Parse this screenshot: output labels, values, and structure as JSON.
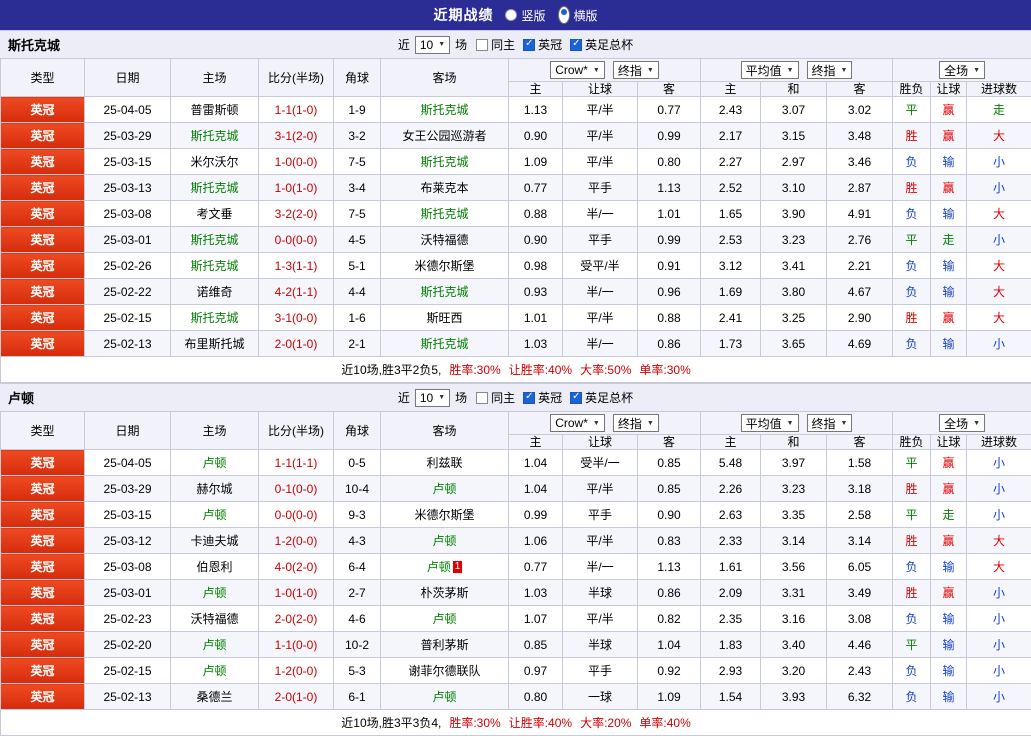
{
  "palette": {
    "topbar_bg": "#2c2c95",
    "league_badge_bg": "#e23b17",
    "team_green": "#008000",
    "score_red": "#cc0000",
    "win_red": "#e00000",
    "draw_green": "#008000",
    "lose_blue": "#1440cc",
    "checkbox_blue": "#1a62d6"
  },
  "topbar": {
    "title": "近期战绩",
    "options": [
      {
        "label": "竖版",
        "selected": false
      },
      {
        "label": "横版",
        "selected": true
      }
    ]
  },
  "filter": {
    "prefix": "近",
    "count": "10",
    "suffix": "场",
    "checkboxes": [
      {
        "label": "同主",
        "checked": false
      },
      {
        "label": "英冠",
        "checked": true
      },
      {
        "label": "英足总杯",
        "checked": true
      }
    ]
  },
  "selects": {
    "asia_source": "Crow*",
    "asia_type": "终指",
    "euro_source": "平均值",
    "euro_type": "终指",
    "full": "全场"
  },
  "table_headers": {
    "cols": [
      "类型",
      "日期",
      "主场",
      "比分(半场)",
      "角球",
      "客场"
    ],
    "asia_sub": [
      "主",
      "让球",
      "客"
    ],
    "euro_sub": [
      "主",
      "和",
      "客"
    ],
    "full_sub": [
      "胜负",
      "让球",
      "进球数"
    ]
  },
  "sections": [
    {
      "team": "斯托克城",
      "rows": [
        {
          "league": "英冠",
          "date": "25-04-05",
          "home": "普雷斯顿",
          "home_team": false,
          "score": "1-1(1-0)",
          "corner": "1-9",
          "away": "斯托克城",
          "away_team": true,
          "away_card": "",
          "ah": [
            "1.13",
            "平/半",
            "0.77"
          ],
          "eu": [
            "2.43",
            "3.07",
            "3.02"
          ],
          "res": [
            [
              "平",
              "d"
            ],
            [
              "赢",
              "w"
            ],
            [
              "走",
              "d"
            ]
          ]
        },
        {
          "league": "英冠",
          "date": "25-03-29",
          "home": "斯托克城",
          "home_team": true,
          "score": "3-1(2-0)",
          "corner": "3-2",
          "away": "女王公园巡游者",
          "away_team": false,
          "away_card": "",
          "ah": [
            "0.90",
            "平/半",
            "0.99"
          ],
          "eu": [
            "2.17",
            "3.15",
            "3.48"
          ],
          "res": [
            [
              "胜",
              "w"
            ],
            [
              "赢",
              "w"
            ],
            [
              "大",
              "w"
            ]
          ]
        },
        {
          "league": "英冠",
          "date": "25-03-15",
          "home": "米尔沃尔",
          "home_team": false,
          "score": "1-0(0-0)",
          "corner": "7-5",
          "away": "斯托克城",
          "away_team": true,
          "away_card": "",
          "ah": [
            "1.09",
            "平/半",
            "0.80"
          ],
          "eu": [
            "2.27",
            "2.97",
            "3.46"
          ],
          "res": [
            [
              "负",
              "l"
            ],
            [
              "输",
              "l"
            ],
            [
              "小",
              "l"
            ]
          ]
        },
        {
          "league": "英冠",
          "date": "25-03-13",
          "home": "斯托克城",
          "home_team": true,
          "score": "1-0(1-0)",
          "corner": "3-4",
          "away": "布莱克本",
          "away_team": false,
          "away_card": "",
          "ah": [
            "0.77",
            "平手",
            "1.13"
          ],
          "eu": [
            "2.52",
            "3.10",
            "2.87"
          ],
          "res": [
            [
              "胜",
              "w"
            ],
            [
              "赢",
              "w"
            ],
            [
              "小",
              "l"
            ]
          ]
        },
        {
          "league": "英冠",
          "date": "25-03-08",
          "home": "考文垂",
          "home_team": false,
          "score": "3-2(2-0)",
          "corner": "7-5",
          "away": "斯托克城",
          "away_team": true,
          "away_card": "",
          "ah": [
            "0.88",
            "半/一",
            "1.01"
          ],
          "eu": [
            "1.65",
            "3.90",
            "4.91"
          ],
          "res": [
            [
              "负",
              "l"
            ],
            [
              "输",
              "l"
            ],
            [
              "大",
              "w"
            ]
          ]
        },
        {
          "league": "英冠",
          "date": "25-03-01",
          "home": "斯托克城",
          "home_team": true,
          "score": "0-0(0-0)",
          "corner": "4-5",
          "away": "沃特福德",
          "away_team": false,
          "away_card": "",
          "ah": [
            "0.90",
            "平手",
            "0.99"
          ],
          "eu": [
            "2.53",
            "3.23",
            "2.76"
          ],
          "res": [
            [
              "平",
              "d"
            ],
            [
              "走",
              "d"
            ],
            [
              "小",
              "l"
            ]
          ]
        },
        {
          "league": "英冠",
          "date": "25-02-26",
          "home": "斯托克城",
          "home_team": true,
          "score": "1-3(1-1)",
          "corner": "5-1",
          "away": "米德尔斯堡",
          "away_team": false,
          "away_card": "",
          "ah": [
            "0.98",
            "受平/半",
            "0.91"
          ],
          "eu": [
            "3.12",
            "3.41",
            "2.21"
          ],
          "res": [
            [
              "负",
              "l"
            ],
            [
              "输",
              "l"
            ],
            [
              "大",
              "w"
            ]
          ]
        },
        {
          "league": "英冠",
          "date": "25-02-22",
          "home": "诺维奇",
          "home_team": false,
          "score": "4-2(1-1)",
          "corner": "4-4",
          "away": "斯托克城",
          "away_team": true,
          "away_card": "",
          "ah": [
            "0.93",
            "半/一",
            "0.96"
          ],
          "eu": [
            "1.69",
            "3.80",
            "4.67"
          ],
          "res": [
            [
              "负",
              "l"
            ],
            [
              "输",
              "l"
            ],
            [
              "大",
              "w"
            ]
          ]
        },
        {
          "league": "英冠",
          "date": "25-02-15",
          "home": "斯托克城",
          "home_team": true,
          "score": "3-1(0-0)",
          "corner": "1-6",
          "away": "斯旺西",
          "away_team": false,
          "away_card": "",
          "ah": [
            "1.01",
            "平/半",
            "0.88"
          ],
          "eu": [
            "2.41",
            "3.25",
            "2.90"
          ],
          "res": [
            [
              "胜",
              "w"
            ],
            [
              "赢",
              "w"
            ],
            [
              "大",
              "w"
            ]
          ]
        },
        {
          "league": "英冠",
          "date": "25-02-13",
          "home": "布里斯托城",
          "home_team": false,
          "score": "2-0(1-0)",
          "corner": "2-1",
          "away": "斯托克城",
          "away_team": true,
          "away_card": "",
          "ah": [
            "1.03",
            "半/一",
            "0.86"
          ],
          "eu": [
            "1.73",
            "3.65",
            "4.69"
          ],
          "res": [
            [
              "负",
              "l"
            ],
            [
              "输",
              "l"
            ],
            [
              "小",
              "l"
            ]
          ]
        }
      ],
      "summary": {
        "lead": "近10场,胜3平2负5,",
        "stats": [
          "胜率:30%",
          "让胜率:40%",
          "大率:50%",
          "单率:30%"
        ]
      }
    },
    {
      "team": "卢顿",
      "rows": [
        {
          "league": "英冠",
          "date": "25-04-05",
          "home": "卢顿",
          "home_team": true,
          "score": "1-1(1-1)",
          "corner": "0-5",
          "away": "利兹联",
          "away_team": false,
          "away_card": "",
          "ah": [
            "1.04",
            "受半/一",
            "0.85"
          ],
          "eu": [
            "5.48",
            "3.97",
            "1.58"
          ],
          "res": [
            [
              "平",
              "d"
            ],
            [
              "赢",
              "w"
            ],
            [
              "小",
              "l"
            ]
          ]
        },
        {
          "league": "英冠",
          "date": "25-03-29",
          "home": "赫尔城",
          "home_team": false,
          "score": "0-1(0-0)",
          "corner": "10-4",
          "away": "卢顿",
          "away_team": true,
          "away_card": "",
          "ah": [
            "1.04",
            "平/半",
            "0.85"
          ],
          "eu": [
            "2.26",
            "3.23",
            "3.18"
          ],
          "res": [
            [
              "胜",
              "w"
            ],
            [
              "赢",
              "w"
            ],
            [
              "小",
              "l"
            ]
          ]
        },
        {
          "league": "英冠",
          "date": "25-03-15",
          "home": "卢顿",
          "home_team": true,
          "score": "0-0(0-0)",
          "corner": "9-3",
          "away": "米德尔斯堡",
          "away_team": false,
          "away_card": "",
          "ah": [
            "0.99",
            "平手",
            "0.90"
          ],
          "eu": [
            "2.63",
            "3.35",
            "2.58"
          ],
          "res": [
            [
              "平",
              "d"
            ],
            [
              "走",
              "d"
            ],
            [
              "小",
              "l"
            ]
          ]
        },
        {
          "league": "英冠",
          "date": "25-03-12",
          "home": "卡迪夫城",
          "home_team": false,
          "score": "1-2(0-0)",
          "corner": "4-3",
          "away": "卢顿",
          "away_team": true,
          "away_card": "",
          "ah": [
            "1.06",
            "平/半",
            "0.83"
          ],
          "eu": [
            "2.33",
            "3.14",
            "3.14"
          ],
          "res": [
            [
              "胜",
              "w"
            ],
            [
              "赢",
              "w"
            ],
            [
              "大",
              "w"
            ]
          ]
        },
        {
          "league": "英冠",
          "date": "25-03-08",
          "home": "伯恩利",
          "home_team": false,
          "score": "4-0(2-0)",
          "corner": "6-4",
          "away": "卢顿",
          "away_team": true,
          "away_card": "1",
          "ah": [
            "0.77",
            "半/一",
            "1.13"
          ],
          "eu": [
            "1.61",
            "3.56",
            "6.05"
          ],
          "res": [
            [
              "负",
              "l"
            ],
            [
              "输",
              "l"
            ],
            [
              "大",
              "w"
            ]
          ]
        },
        {
          "league": "英冠",
          "date": "25-03-01",
          "home": "卢顿",
          "home_team": true,
          "score": "1-0(1-0)",
          "corner": "2-7",
          "away": "朴茨茅斯",
          "away_team": false,
          "away_card": "",
          "ah": [
            "1.03",
            "半球",
            "0.86"
          ],
          "eu": [
            "2.09",
            "3.31",
            "3.49"
          ],
          "res": [
            [
              "胜",
              "w"
            ],
            [
              "赢",
              "w"
            ],
            [
              "小",
              "l"
            ]
          ]
        },
        {
          "league": "英冠",
          "date": "25-02-23",
          "home": "沃特福德",
          "home_team": false,
          "score": "2-0(2-0)",
          "corner": "4-6",
          "away": "卢顿",
          "away_team": true,
          "away_card": "",
          "ah": [
            "1.07",
            "平/半",
            "0.82"
          ],
          "eu": [
            "2.35",
            "3.16",
            "3.08"
          ],
          "res": [
            [
              "负",
              "l"
            ],
            [
              "输",
              "l"
            ],
            [
              "小",
              "l"
            ]
          ]
        },
        {
          "league": "英冠",
          "date": "25-02-20",
          "home": "卢顿",
          "home_team": true,
          "score": "1-1(0-0)",
          "corner": "10-2",
          "away": "普利茅斯",
          "away_team": false,
          "away_card": "",
          "ah": [
            "0.85",
            "半球",
            "1.04"
          ],
          "eu": [
            "1.83",
            "3.40",
            "4.46"
          ],
          "res": [
            [
              "平",
              "d"
            ],
            [
              "输",
              "l"
            ],
            [
              "小",
              "l"
            ]
          ]
        },
        {
          "league": "英冠",
          "date": "25-02-15",
          "home": "卢顿",
          "home_team": true,
          "score": "1-2(0-0)",
          "corner": "5-3",
          "away": "谢菲尔德联队",
          "away_team": false,
          "away_card": "",
          "ah": [
            "0.97",
            "平手",
            "0.92"
          ],
          "eu": [
            "2.93",
            "3.20",
            "2.43"
          ],
          "res": [
            [
              "负",
              "l"
            ],
            [
              "输",
              "l"
            ],
            [
              "小",
              "l"
            ]
          ]
        },
        {
          "league": "英冠",
          "date": "25-02-13",
          "home": "桑德兰",
          "home_team": false,
          "score": "2-0(1-0)",
          "corner": "6-1",
          "away": "卢顿",
          "away_team": true,
          "away_card": "",
          "ah": [
            "0.80",
            "一球",
            "1.09"
          ],
          "eu": [
            "1.54",
            "3.93",
            "6.32"
          ],
          "res": [
            [
              "负",
              "l"
            ],
            [
              "输",
              "l"
            ],
            [
              "小",
              "l"
            ]
          ]
        }
      ],
      "summary": {
        "lead": "近10场,胜3平3负4,",
        "stats": [
          "胜率:30%",
          "让胜率:40%",
          "大率:20%",
          "单率:40%"
        ]
      }
    }
  ]
}
